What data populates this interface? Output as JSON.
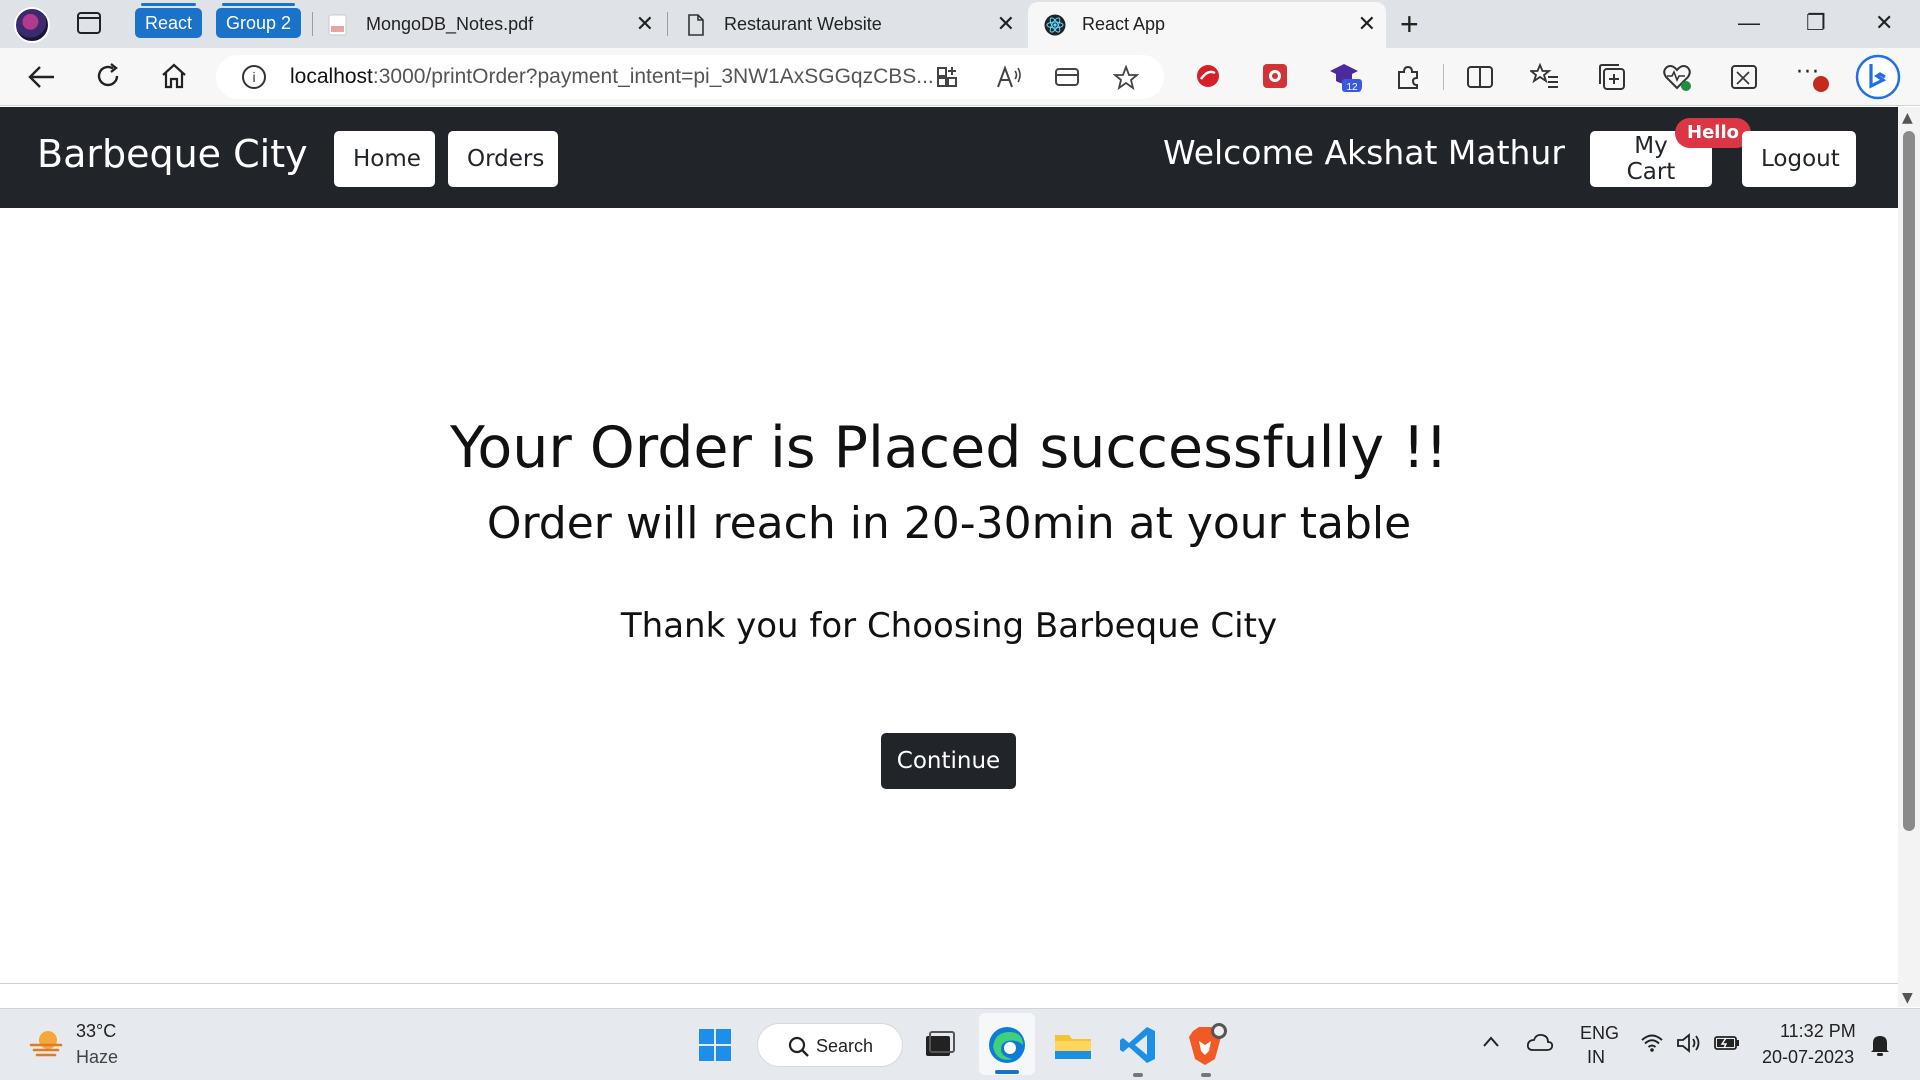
{
  "browser": {
    "tab_groups": [
      "React",
      "Group 2"
    ],
    "tabs": [
      {
        "title": "MongoDB_Notes.pdf",
        "icon": "pdf-icon",
        "active": false
      },
      {
        "title": "Restaurant Website",
        "icon": "page-icon",
        "active": false
      },
      {
        "title": "React App",
        "icon": "react-icon",
        "active": true
      }
    ],
    "new_tab": "+",
    "close_glyph": "✕",
    "window_controls": {
      "minimize": "—",
      "restore": "❐",
      "close": "✕"
    },
    "address": {
      "host": "localhost",
      "rest": ":3000/printOrder?payment_intent=pi_3NW1AxSGGqzCBS..."
    },
    "more_glyph": "···"
  },
  "navbar": {
    "brand": "Barbeque City",
    "home": "Home",
    "orders": "Orders",
    "welcome": "Welcome Akshat Mathur",
    "cart": "My Cart",
    "cart_badge": "Hello",
    "logout": "Logout"
  },
  "main": {
    "heading": "Your Order is Placed successfully !!",
    "subheading": "Order will reach in 20-30min at your table",
    "thanks": "Thank you for Choosing Barbeque City",
    "continue": "Continue"
  },
  "taskbar": {
    "weather": {
      "temp": "33°C",
      "desc": "Haze"
    },
    "search": "Search",
    "language": "ENG",
    "region": "IN",
    "time": "11:32 PM",
    "date": "20-07-2023"
  },
  "colors": {
    "navbar_bg": "#212529",
    "badge_bg": "#dc3545",
    "tab_group": "#1a73c8",
    "button_dark": "#212529"
  }
}
